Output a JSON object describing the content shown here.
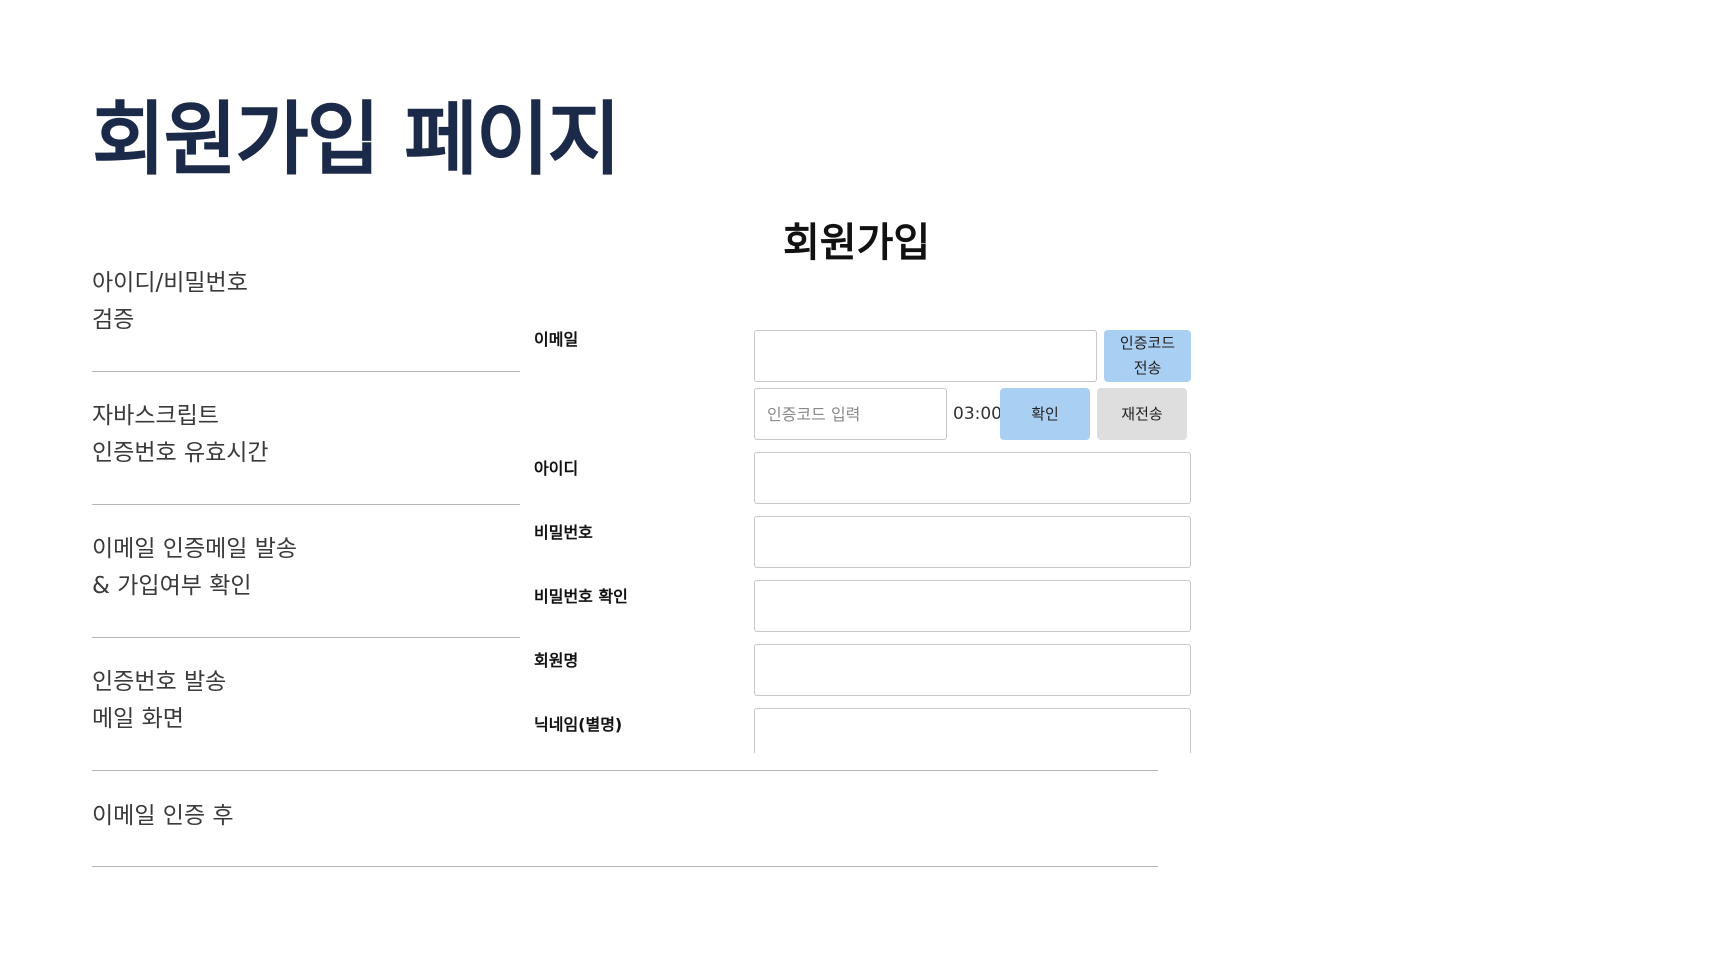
{
  "page": {
    "title": "회원가입 페이지"
  },
  "sidebar": {
    "items": [
      {
        "line1": "아이디/비밀번호",
        "line2": "검증"
      },
      {
        "line1": "자바스크립트",
        "line2": "인증번호 유효시간"
      },
      {
        "line1": "이메일 인증메일 발송",
        "line2": "& 가입여부 확인"
      },
      {
        "line1": "인증번호 발송",
        "line2": "메일 화면"
      },
      {
        "line1": "이메일 인증 후",
        "line2": ""
      }
    ]
  },
  "form": {
    "title": "회원가입",
    "email_label": "이메일",
    "email_value": "",
    "send_code_button": "인증코드\n전송",
    "code_placeholder": "인증코드 입력",
    "timer": "03:00",
    "confirm_button": "확인",
    "resend_button": "재전송",
    "id_label": "아이디",
    "password_label": "비밀번호",
    "password_confirm_label": "비밀번호 확인",
    "name_label": "회원명",
    "nickname_label": "닉네임(별명)"
  },
  "colors": {
    "title": "#1c2a4a",
    "button_blue": "#a9cff3",
    "button_gray": "#dedede",
    "divider": "#b5b5b5"
  }
}
